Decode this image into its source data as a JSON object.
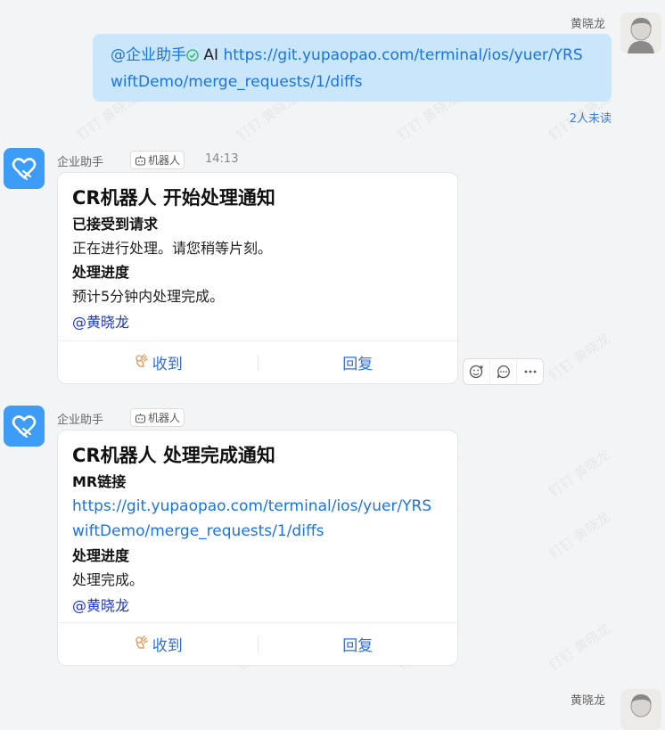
{
  "out_message": {
    "sender_name": "黄晓龙",
    "mention": "@企业助手",
    "prefix_text": "AI",
    "link": "https://git.yupaopao.com/terminal/ios/yuer/YRSwiftDemo/merge_requests/1/diffs",
    "read_status": "2人未读"
  },
  "msg1": {
    "sender_name": "企业助手",
    "badge": "机器人",
    "time": "14:13",
    "title": "CR机器人 开始处理通知",
    "section1_heading": "已接受到请求",
    "section1_text": "正在进行处理。请您稍等片刻。",
    "section2_heading": "处理进度",
    "section2_text": "预计5分钟内处理完成。",
    "at_user": "@黄晓龙",
    "btn_receive": "收到",
    "btn_reply": "回复"
  },
  "msg2": {
    "sender_name": "企业助手",
    "badge": "机器人",
    "title": "CR机器人 处理完成通知",
    "section1_heading": "MR链接",
    "link": "https://git.yupaopao.com/terminal/ios/yuer/YRSwiftDemo/merge_requests/1/diffs",
    "section2_heading": "处理进度",
    "section2_text": "处理完成。",
    "at_user": "@黄晓龙",
    "btn_receive": "收到",
    "btn_reply": "回复"
  },
  "bottom_message": {
    "sender_name": "黄晓龙"
  },
  "watermark": "钉钉 黄晓龙",
  "colors": {
    "bubble_out": "#c9e6fb",
    "bot_avatar": "#3c9cf6",
    "link": "#1a73e8"
  }
}
